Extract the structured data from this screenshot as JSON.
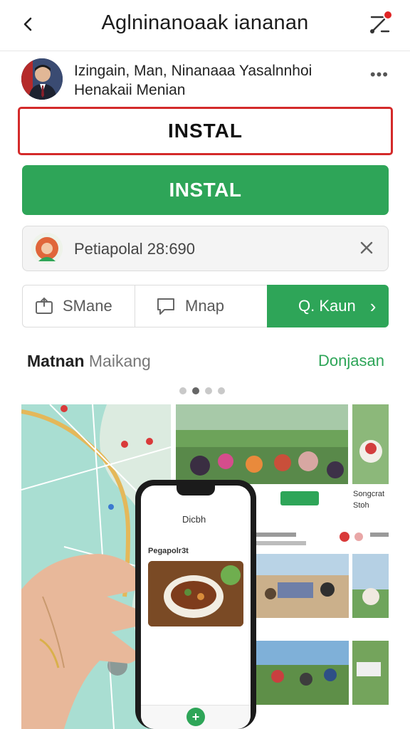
{
  "header": {
    "title": "Aglninanoaak iananan",
    "back_icon": "chevron-left-icon",
    "edit_icon": "edit-icon"
  },
  "profile": {
    "line1": "Izingain, Man, Ninanaaa Yasalnnhoi",
    "line2": "Henakaii Menian",
    "more_label": "•••"
  },
  "buttons": {
    "install_outline": "INSTAL",
    "install_primary": "INSTAL"
  },
  "notice": {
    "text": "Petiapolal 28:690",
    "close_icon": "close-icon"
  },
  "actions": {
    "share_label": "SMane",
    "map_label": "Mnap",
    "primary_label": "Q. Kaun",
    "primary_chevron": "›"
  },
  "section": {
    "title_bold": "Matnan",
    "title_light": "Maikang",
    "link": "Donjasan"
  },
  "gallery": {
    "side_text_1": "Songcrat",
    "side_text_2": "Stoh",
    "phone_title": "Dicbh",
    "phone_subtitle": "Pegapolr3t",
    "phone_plus": "+"
  },
  "colors": {
    "accent_green": "#2ea558",
    "alert_red": "#d42a2a",
    "notification_red": "#e02424"
  }
}
